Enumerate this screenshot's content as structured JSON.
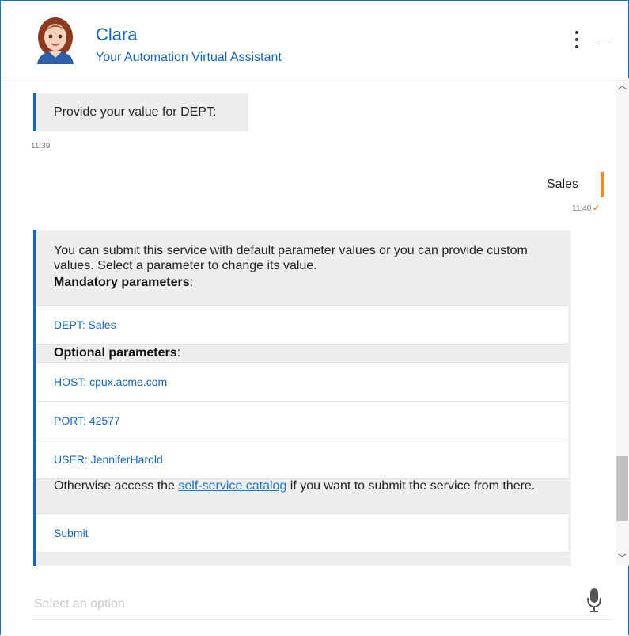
{
  "header": {
    "name": "Clara",
    "subtitle": "Your Automation Virtual Assistant"
  },
  "messages": {
    "bot_prompt": "Provide your value for DEPT:",
    "bot_prompt_time": "11:39",
    "user_reply": "Sales",
    "user_reply_time": "11:40",
    "card": {
      "intro": "You can submit this service with default parameter values or you can provide custom values. Select a parameter to change its value.",
      "mandatory_label": "Mandatory parameters",
      "mandatory_options": [
        "DEPT: Sales"
      ],
      "optional_label": "Optional parameters",
      "optional_options": [
        "HOST: cpux.acme.com",
        "PORT: 42577",
        "USER: JenniferHarold"
      ],
      "outro_before": "Otherwise access the ",
      "outro_link": "self-service catalog",
      "outro_after": " if you want to submit the service from there.",
      "submit_label": "Submit"
    }
  },
  "input": {
    "placeholder": "Select an option",
    "value": ""
  },
  "colors": {
    "accent": "#1565b8",
    "user_accent": "#f28c1e",
    "bubble": "#eeeeee"
  },
  "icons": {
    "menu": "vertical-ellipsis-icon",
    "minimize": "minimize-icon",
    "mic": "microphone-icon",
    "read_receipt": "checkmark-icon"
  }
}
